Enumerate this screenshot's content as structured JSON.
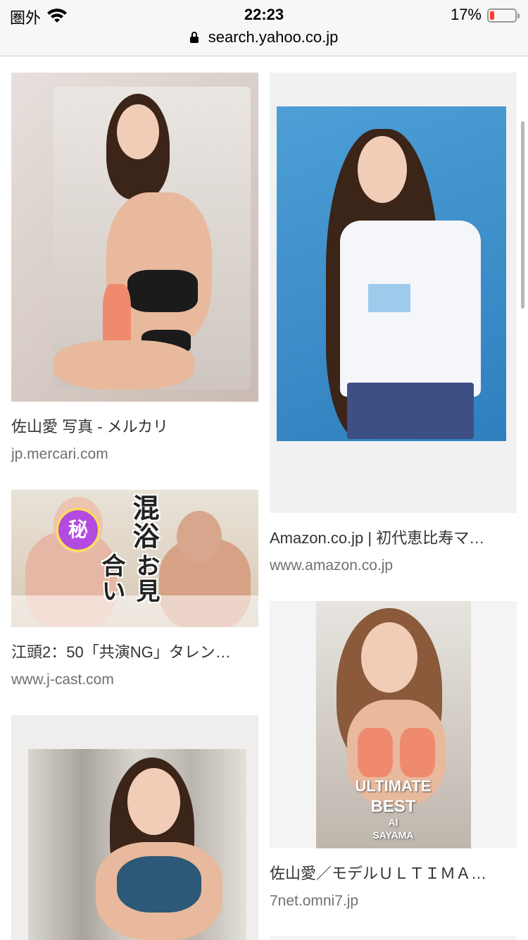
{
  "status_bar": {
    "carrier": "圏外",
    "time": "22:23",
    "battery_percent": "17%",
    "battery_level": 0.17,
    "battery_color": "#ff3b30"
  },
  "url_bar": {
    "domain": "search.yahoo.co.jp",
    "icon": "lock-icon"
  },
  "results": [
    {
      "title": "佐山愛 写真 - メルカリ",
      "source": "jp.mercari.com"
    },
    {
      "title": "Amazon.co.jp | 初代恵比寿マ…",
      "source": "www.amazon.co.jp"
    },
    {
      "title": "江頭2：50「共演NG」タレン…",
      "source": "www.j-cast.com",
      "image_text": {
        "badge": "秘",
        "line1": "混浴",
        "line2": "お見合い"
      }
    },
    {
      "title": "佐山愛／モデルＵＬＴＩＭＡ…",
      "source": "7net.omni7.jp",
      "image_text": {
        "line1": "ULTIMATE",
        "line2": "BEST",
        "line3": "AI",
        "line4": "SAYAMA"
      }
    },
    {
      "title": "",
      "source": ""
    }
  ]
}
